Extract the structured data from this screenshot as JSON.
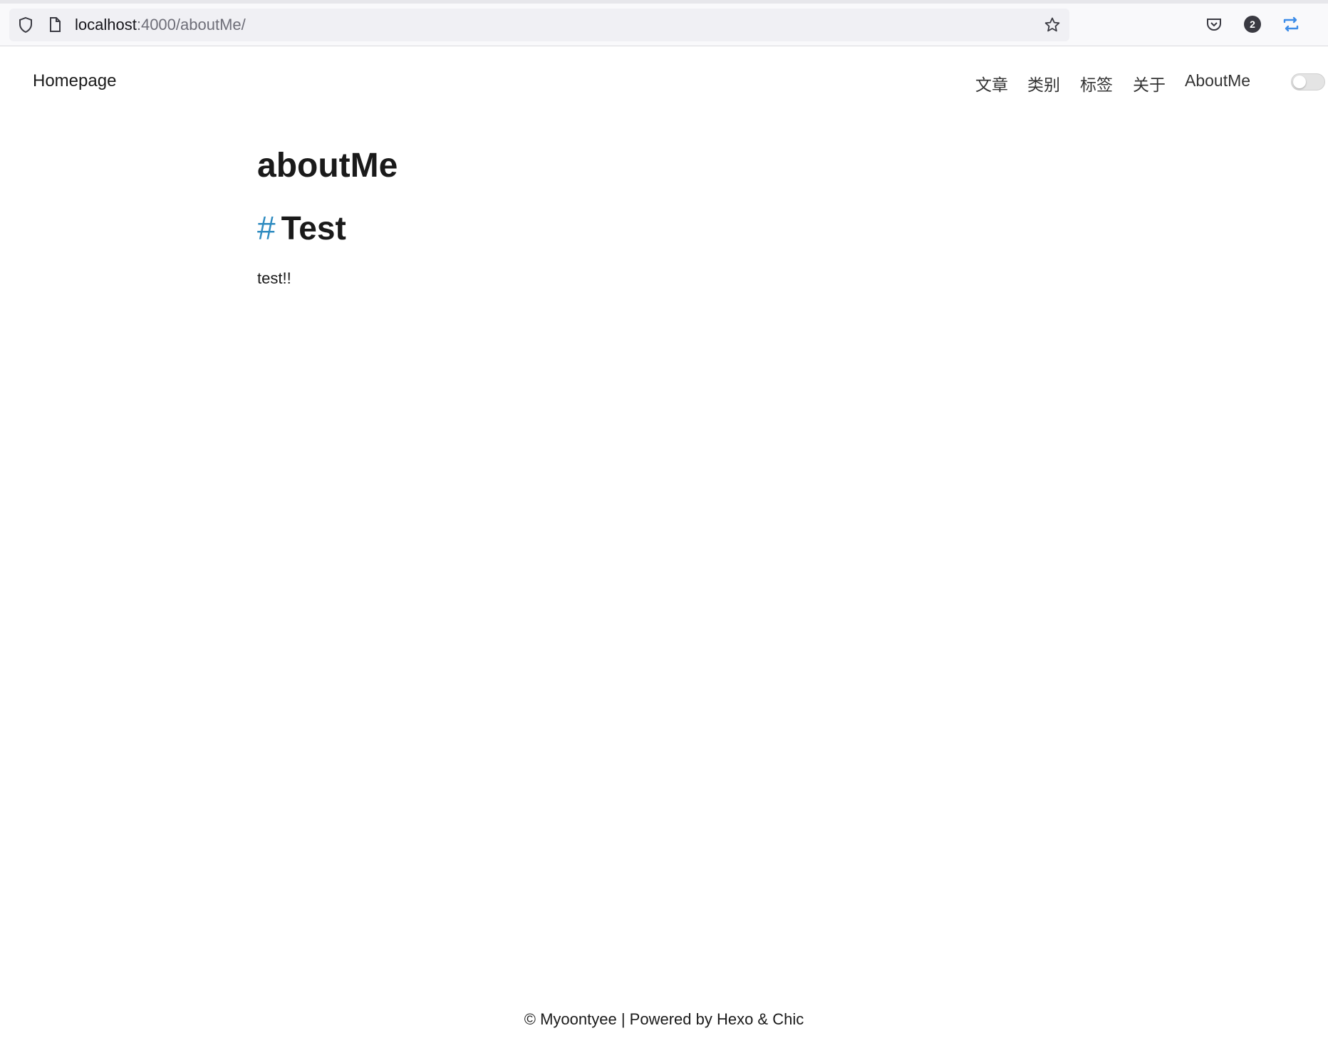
{
  "browser": {
    "url_host": "localhost",
    "url_path": ":4000/aboutMe/",
    "badge_count": "2",
    "icons": [
      "shield-icon",
      "page-icon",
      "star-icon",
      "pocket-icon",
      "extension-badge-icon",
      "sync-icon"
    ]
  },
  "nav": {
    "brand": "Homepage",
    "items": [
      {
        "label": "文章"
      },
      {
        "label": "类别"
      },
      {
        "label": "标签"
      },
      {
        "label": "关于"
      },
      {
        "label": "AboutMe"
      }
    ]
  },
  "main": {
    "title": "aboutMe",
    "section_hash": "#",
    "section_title": "Test",
    "paragraph": "test!!"
  },
  "footer": {
    "text": "© Myoontyee | Powered by Hexo & Chic"
  },
  "colors": {
    "accent": "#2e8bc0",
    "text": "#1a1a1a"
  }
}
